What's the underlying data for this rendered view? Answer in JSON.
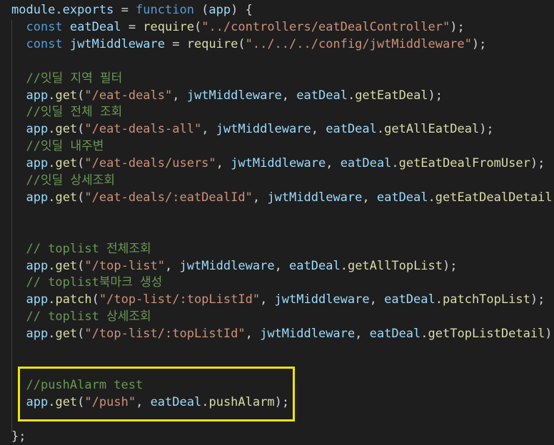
{
  "editor": {
    "lines": [
      [
        {
          "t": "module",
          "c": "v"
        },
        {
          "t": ".",
          "c": "p"
        },
        {
          "t": "exports",
          "c": "v"
        },
        {
          "t": " = ",
          "c": "p"
        },
        {
          "t": "function",
          "c": "k"
        },
        {
          "t": " (",
          "c": "p"
        },
        {
          "t": "app",
          "c": "v"
        },
        {
          "t": ") {",
          "c": "p"
        }
      ],
      [
        {
          "t": "  ",
          "c": "p"
        },
        {
          "t": "const",
          "c": "k"
        },
        {
          "t": " ",
          "c": "p"
        },
        {
          "t": "eatDeal",
          "c": "v"
        },
        {
          "t": " = ",
          "c": "p"
        },
        {
          "t": "require",
          "c": "f"
        },
        {
          "t": "(",
          "c": "p"
        },
        {
          "t": "\"../controllers/eatDealController\"",
          "c": "s"
        },
        {
          "t": ");",
          "c": "p"
        }
      ],
      [
        {
          "t": "  ",
          "c": "p"
        },
        {
          "t": "const",
          "c": "k"
        },
        {
          "t": " ",
          "c": "p"
        },
        {
          "t": "jwtMiddleware",
          "c": "v"
        },
        {
          "t": " = ",
          "c": "p"
        },
        {
          "t": "require",
          "c": "f"
        },
        {
          "t": "(",
          "c": "p"
        },
        {
          "t": "\"../../../config/jwtMiddleware\"",
          "c": "s"
        },
        {
          "t": ");",
          "c": "p"
        }
      ],
      [],
      [
        {
          "t": "  ",
          "c": "p"
        },
        {
          "t": "//잇딜 지역 필터",
          "c": "c"
        }
      ],
      [
        {
          "t": "  ",
          "c": "p"
        },
        {
          "t": "app",
          "c": "v"
        },
        {
          "t": ".",
          "c": "p"
        },
        {
          "t": "get",
          "c": "f"
        },
        {
          "t": "(",
          "c": "p"
        },
        {
          "t": "\"/eat-deals\"",
          "c": "s"
        },
        {
          "t": ", ",
          "c": "p"
        },
        {
          "t": "jwtMiddleware",
          "c": "v"
        },
        {
          "t": ", ",
          "c": "p"
        },
        {
          "t": "eatDeal",
          "c": "v"
        },
        {
          "t": ".",
          "c": "p"
        },
        {
          "t": "getEatDeal",
          "c": "f"
        },
        {
          "t": ");",
          "c": "p"
        }
      ],
      [
        {
          "t": "  ",
          "c": "p"
        },
        {
          "t": "//잇딜 전체 조회",
          "c": "c"
        }
      ],
      [
        {
          "t": "  ",
          "c": "p"
        },
        {
          "t": "app",
          "c": "v"
        },
        {
          "t": ".",
          "c": "p"
        },
        {
          "t": "get",
          "c": "f"
        },
        {
          "t": "(",
          "c": "p"
        },
        {
          "t": "\"/eat-deals-all\"",
          "c": "s"
        },
        {
          "t": ", ",
          "c": "p"
        },
        {
          "t": "jwtMiddleware",
          "c": "v"
        },
        {
          "t": ", ",
          "c": "p"
        },
        {
          "t": "eatDeal",
          "c": "v"
        },
        {
          "t": ".",
          "c": "p"
        },
        {
          "t": "getAllEatDeal",
          "c": "f"
        },
        {
          "t": ");",
          "c": "p"
        }
      ],
      [
        {
          "t": "  ",
          "c": "p"
        },
        {
          "t": "//잇딜 내주변",
          "c": "c"
        }
      ],
      [
        {
          "t": "  ",
          "c": "p"
        },
        {
          "t": "app",
          "c": "v"
        },
        {
          "t": ".",
          "c": "p"
        },
        {
          "t": "get",
          "c": "f"
        },
        {
          "t": "(",
          "c": "p"
        },
        {
          "t": "\"/eat-deals/users\"",
          "c": "s"
        },
        {
          "t": ", ",
          "c": "p"
        },
        {
          "t": "jwtMiddleware",
          "c": "v"
        },
        {
          "t": ", ",
          "c": "p"
        },
        {
          "t": "eatDeal",
          "c": "v"
        },
        {
          "t": ".",
          "c": "p"
        },
        {
          "t": "getEatDealFromUser",
          "c": "f"
        },
        {
          "t": ");",
          "c": "p"
        }
      ],
      [
        {
          "t": "  ",
          "c": "p"
        },
        {
          "t": "//잇딜 상세조회",
          "c": "c"
        }
      ],
      [
        {
          "t": "  ",
          "c": "p"
        },
        {
          "t": "app",
          "c": "v"
        },
        {
          "t": ".",
          "c": "p"
        },
        {
          "t": "get",
          "c": "f"
        },
        {
          "t": "(",
          "c": "p"
        },
        {
          "t": "\"/eat-deals/:eatDealId\"",
          "c": "s"
        },
        {
          "t": ", ",
          "c": "p"
        },
        {
          "t": "jwtMiddleware",
          "c": "v"
        },
        {
          "t": ", ",
          "c": "p"
        },
        {
          "t": "eatDeal",
          "c": "v"
        },
        {
          "t": ".",
          "c": "p"
        },
        {
          "t": "getEatDealDetail",
          "c": "f"
        },
        {
          "t": ");",
          "c": "p"
        }
      ],
      [],
      [],
      [
        {
          "t": "  ",
          "c": "p"
        },
        {
          "t": "// toplist 전체조회",
          "c": "c"
        }
      ],
      [
        {
          "t": "  ",
          "c": "p"
        },
        {
          "t": "app",
          "c": "v"
        },
        {
          "t": ".",
          "c": "p"
        },
        {
          "t": "get",
          "c": "f"
        },
        {
          "t": "(",
          "c": "p"
        },
        {
          "t": "\"/top-list\"",
          "c": "s"
        },
        {
          "t": ", ",
          "c": "p"
        },
        {
          "t": "jwtMiddleware",
          "c": "v"
        },
        {
          "t": ", ",
          "c": "p"
        },
        {
          "t": "eatDeal",
          "c": "v"
        },
        {
          "t": ".",
          "c": "p"
        },
        {
          "t": "getAllTopList",
          "c": "f"
        },
        {
          "t": ");",
          "c": "p"
        }
      ],
      [
        {
          "t": "  ",
          "c": "p"
        },
        {
          "t": "// toplist북마크 생성",
          "c": "c"
        }
      ],
      [
        {
          "t": "  ",
          "c": "p"
        },
        {
          "t": "app",
          "c": "v"
        },
        {
          "t": ".",
          "c": "p"
        },
        {
          "t": "patch",
          "c": "f"
        },
        {
          "t": "(",
          "c": "p"
        },
        {
          "t": "\"/top-list/:topListId\"",
          "c": "s"
        },
        {
          "t": ", ",
          "c": "p"
        },
        {
          "t": "jwtMiddleware",
          "c": "v"
        },
        {
          "t": ", ",
          "c": "p"
        },
        {
          "t": "eatDeal",
          "c": "v"
        },
        {
          "t": ".",
          "c": "p"
        },
        {
          "t": "patchTopList",
          "c": "f"
        },
        {
          "t": ");",
          "c": "p"
        }
      ],
      [
        {
          "t": "  ",
          "c": "p"
        },
        {
          "t": "// toplist 상세조회",
          "c": "c"
        }
      ],
      [
        {
          "t": "  ",
          "c": "p"
        },
        {
          "t": "app",
          "c": "v"
        },
        {
          "t": ".",
          "c": "p"
        },
        {
          "t": "get",
          "c": "f"
        },
        {
          "t": "(",
          "c": "p"
        },
        {
          "t": "\"/top-list/:topListId\"",
          "c": "s"
        },
        {
          "t": ", ",
          "c": "p"
        },
        {
          "t": "jwtMiddleware",
          "c": "v"
        },
        {
          "t": ", ",
          "c": "p"
        },
        {
          "t": "eatDeal",
          "c": "v"
        },
        {
          "t": ".",
          "c": "p"
        },
        {
          "t": "getTopListDetail",
          "c": "f"
        },
        {
          "t": ");",
          "c": "p"
        }
      ],
      [],
      [],
      [
        {
          "t": "  ",
          "c": "p"
        },
        {
          "t": "//pushAlarm test",
          "c": "c"
        }
      ],
      [
        {
          "t": "  ",
          "c": "p"
        },
        {
          "t": "app",
          "c": "v"
        },
        {
          "t": ".",
          "c": "p"
        },
        {
          "t": "get",
          "c": "f"
        },
        {
          "t": "(",
          "c": "p"
        },
        {
          "t": "\"/push\"",
          "c": "s"
        },
        {
          "t": ", ",
          "c": "p"
        },
        {
          "t": "eatDeal",
          "c": "v"
        },
        {
          "t": ".",
          "c": "p"
        },
        {
          "t": "pushAlarm",
          "c": "f"
        },
        {
          "t": ");",
          "c": "p"
        }
      ],
      [],
      [
        {
          "t": "};",
          "c": "p"
        }
      ]
    ]
  },
  "colors": {
    "background": "#1e1e1e",
    "keyword": "#569cd6",
    "variable": "#9cdcfe",
    "function": "#dcdcaa",
    "string": "#ce9178",
    "comment": "#6a9955",
    "highlight_box": "#f2e500"
  }
}
